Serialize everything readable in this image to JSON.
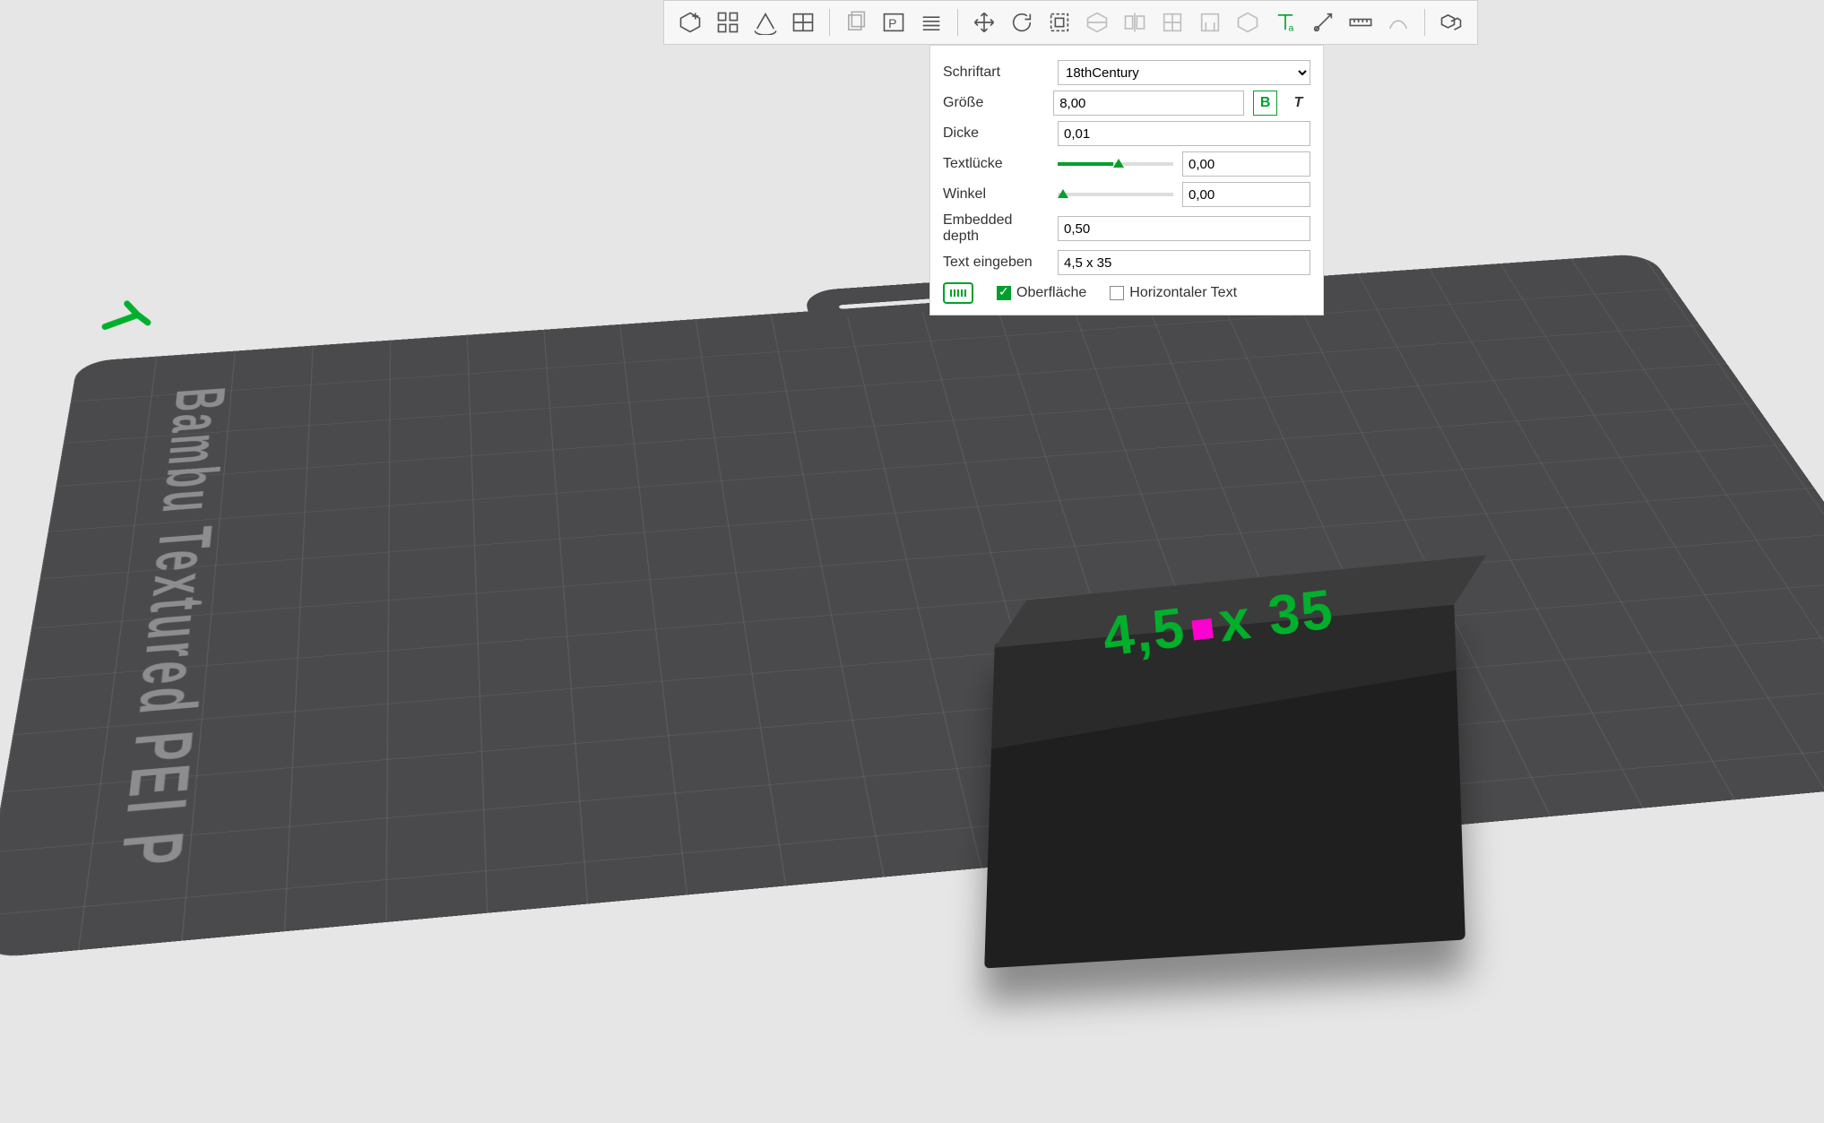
{
  "plate": {
    "label": "Bambu Textured PEI P"
  },
  "model_text": {
    "left": "4,5",
    "right": "35"
  },
  "axis_glyph": "⌇",
  "toolbar": {
    "icons": [
      "add",
      "arrange",
      "autoorient",
      "splitview",
      "clone",
      "platesetup",
      "layers",
      "move",
      "rotate",
      "scale",
      "cut",
      "mirror",
      "mesh",
      "support",
      "boolean",
      "text",
      "measure",
      "ruler",
      "seam",
      "variable"
    ]
  },
  "panel": {
    "font_label": "Schriftart",
    "font_value": "18thCentury",
    "size_label": "Größe",
    "size_value": "8,00",
    "bold": "B",
    "italic": "T",
    "thick_label": "Dicke",
    "thick_value": "0,01",
    "gap_label": "Textlücke",
    "gap_value": "0,00",
    "gap_slider_pct": 48,
    "angle_label": "Winkel",
    "angle_value": "0,00",
    "angle_slider_pct": 0,
    "embed_label1": "Embedded",
    "embed_label2": "depth",
    "embed_value": "0,50",
    "text_label": "Text eingeben",
    "text_value": "4,5 x 35",
    "surface": "Oberfläche",
    "horizontal": "Horizontaler Text"
  }
}
